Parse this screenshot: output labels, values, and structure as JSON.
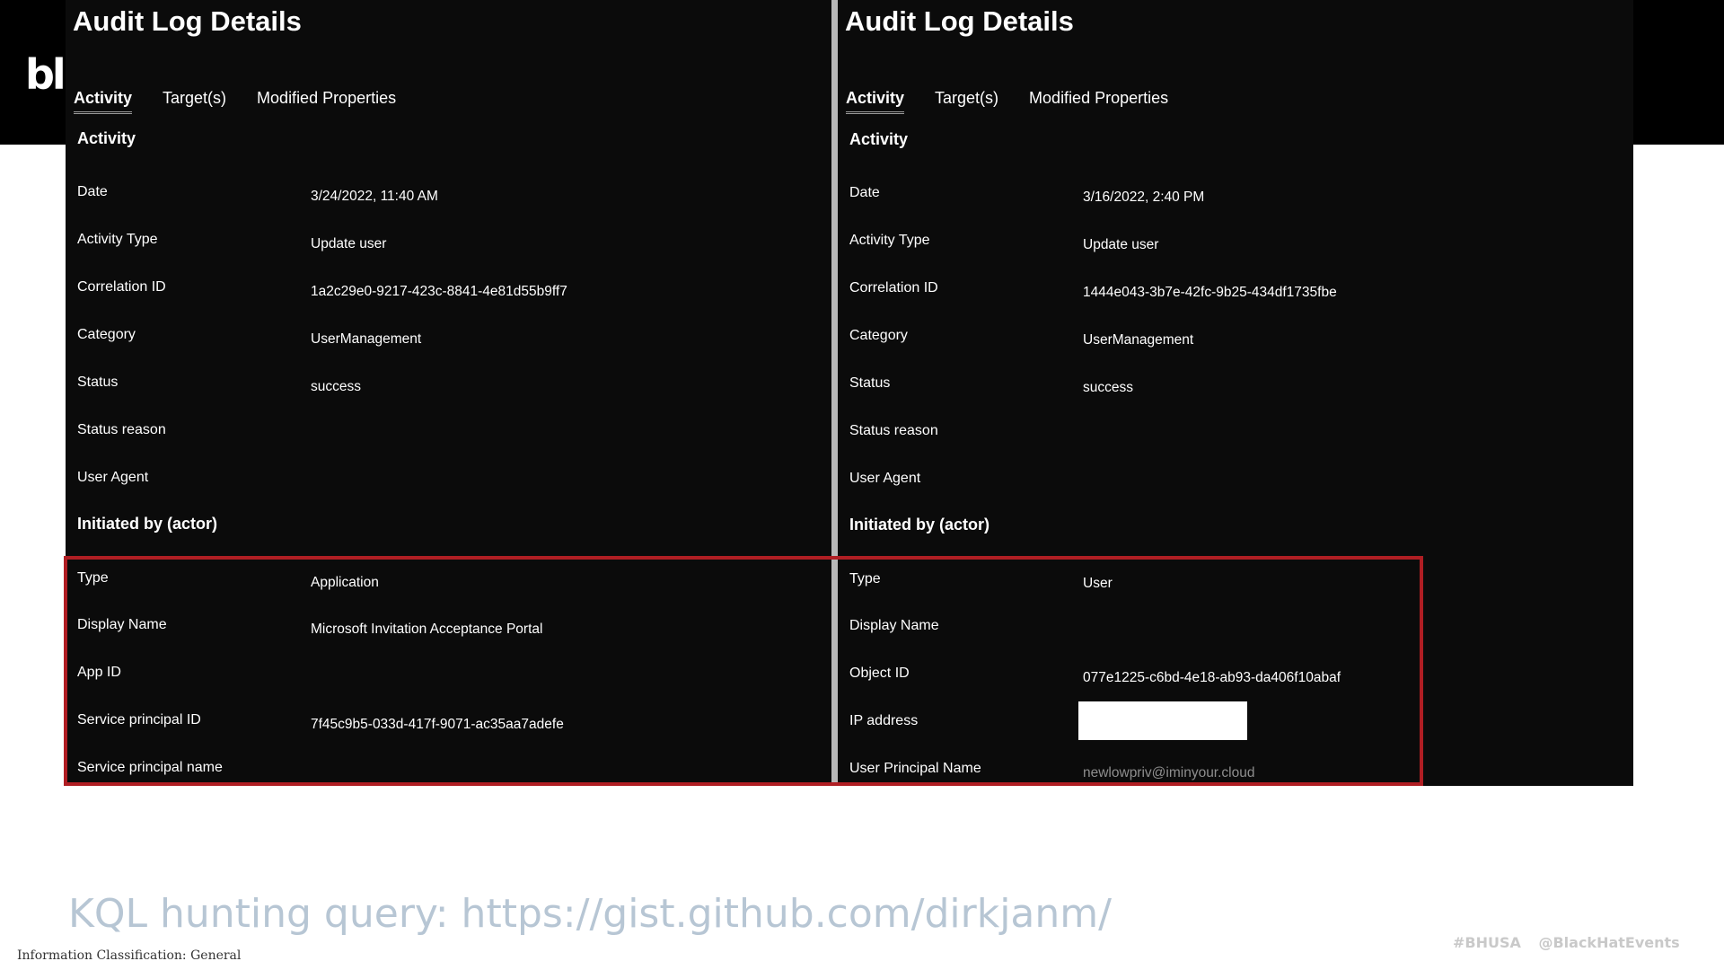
{
  "logo_text": "bl",
  "left": {
    "title": "Audit Log Details",
    "tabs": [
      "Activity",
      "Target(s)",
      "Modified Properties"
    ],
    "activity_heading": "Activity",
    "activity_rows": [
      {
        "label": "Date",
        "value": "3/24/2022, 11:40 AM"
      },
      {
        "label": "Activity Type",
        "value": "Update user"
      },
      {
        "label": "Correlation ID",
        "value": "1a2c29e0-9217-423c-8841-4e81d55b9ff7"
      },
      {
        "label": "Category",
        "value": "UserManagement"
      },
      {
        "label": "Status",
        "value": "success"
      },
      {
        "label": "Status reason",
        "value": ""
      },
      {
        "label": "User Agent",
        "value": ""
      }
    ],
    "actor_heading": "Initiated by (actor)",
    "actor_rows": [
      {
        "label": "Type",
        "value": "Application"
      },
      {
        "label": "Display Name",
        "value": "Microsoft Invitation Acceptance Portal"
      },
      {
        "label": "App ID",
        "value": ""
      },
      {
        "label": "Service principal ID",
        "value": "7f45c9b5-033d-417f-9071-ac35aa7adefe"
      },
      {
        "label": "Service principal name",
        "value": ""
      }
    ]
  },
  "right": {
    "title": "Audit Log Details",
    "tabs": [
      "Activity",
      "Target(s)",
      "Modified Properties"
    ],
    "activity_heading": "Activity",
    "activity_rows": [
      {
        "label": "Date",
        "value": "3/16/2022, 2:40 PM"
      },
      {
        "label": "Activity Type",
        "value": "Update user"
      },
      {
        "label": "Correlation ID",
        "value": "1444e043-3b7e-42fc-9b25-434df1735fbe"
      },
      {
        "label": "Category",
        "value": "UserManagement"
      },
      {
        "label": "Status",
        "value": "success"
      },
      {
        "label": "Status reason",
        "value": ""
      },
      {
        "label": "User Agent",
        "value": ""
      }
    ],
    "actor_heading": "Initiated by (actor)",
    "actor_rows": [
      {
        "label": "Type",
        "value": "User"
      },
      {
        "label": "Display Name",
        "value": ""
      },
      {
        "label": "Object ID",
        "value": "077e1225-c6bd-4e18-ab93-da406f10abaf"
      },
      {
        "label": "IP address",
        "value": ""
      },
      {
        "label": "User Principal Name",
        "value": "newlowpriv@iminyour.cloud"
      }
    ]
  },
  "kql_text": "KQL hunting query: https://gist.github.com/dirkjanm/",
  "footer_classification": "Information Classification: General",
  "footer_tags": "#BHUSA @BlackHatEvents",
  "colors": {
    "highlight_border": "#b01e23",
    "panel_bg": "#0b0b0b",
    "kql_text": "#b7c6d4"
  }
}
